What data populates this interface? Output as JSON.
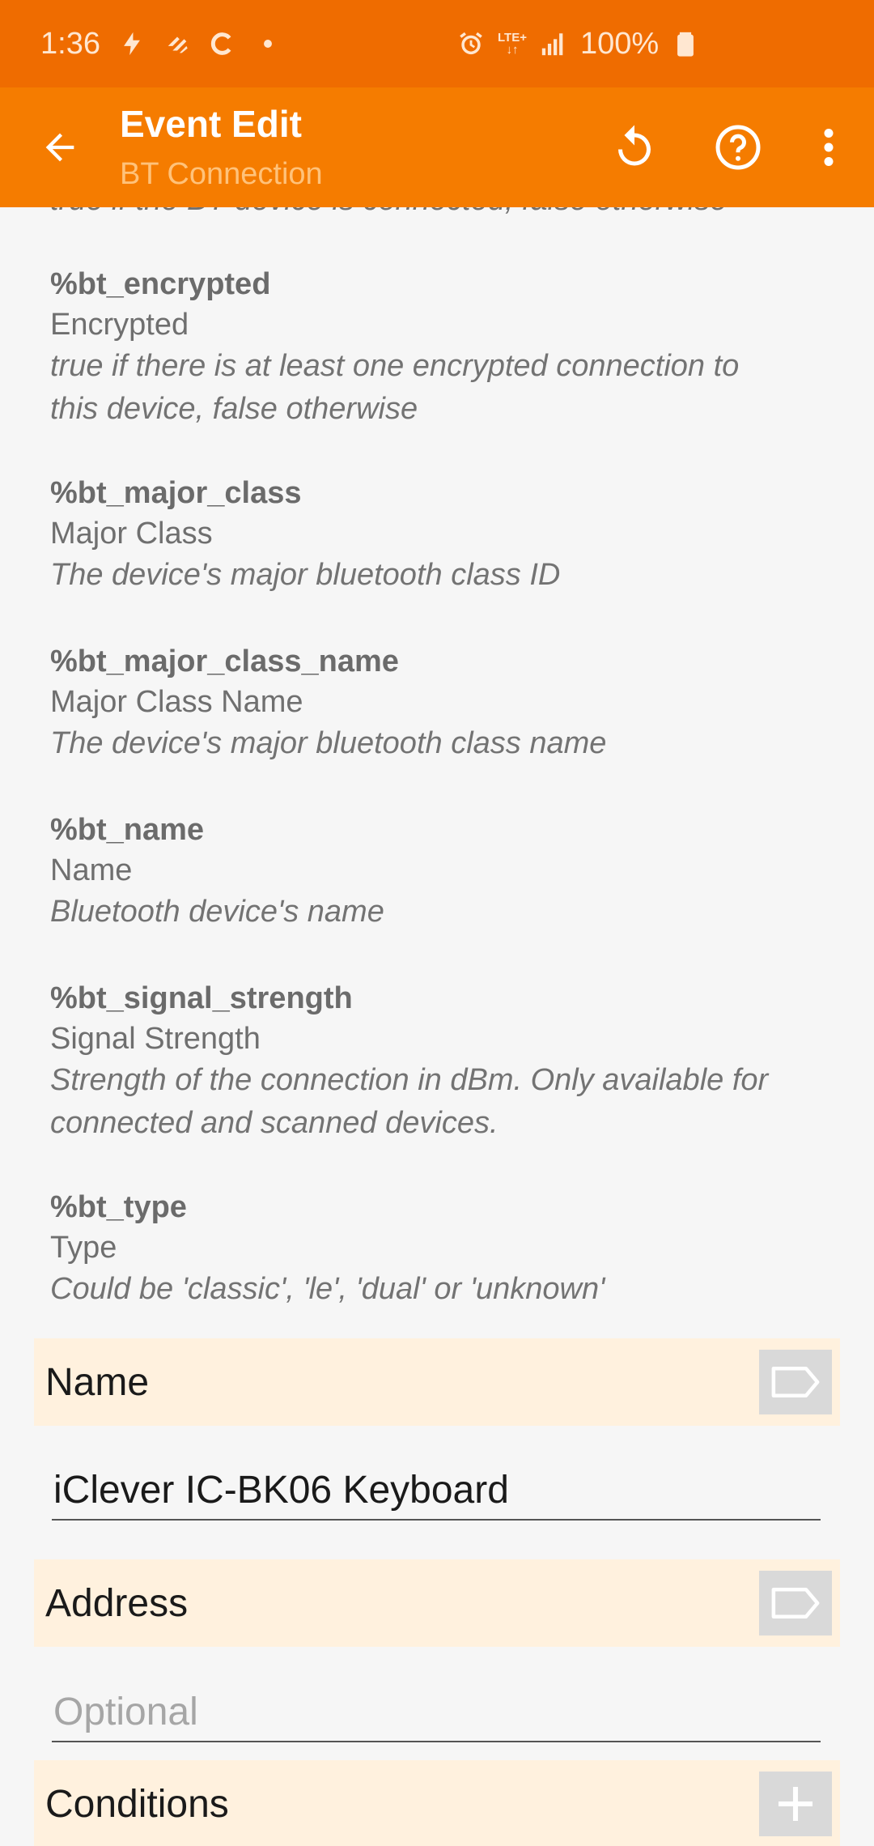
{
  "status_bar": {
    "time": "1:36",
    "battery": "100%",
    "left_icons": [
      "flash-icon",
      "bolt-app-icon",
      "c-icon",
      "dot-icon"
    ],
    "right_icons": [
      "alarm-icon",
      "lte-icon",
      "signal-icon",
      "battery-icon"
    ],
    "lte_label": "LTE+"
  },
  "app_bar": {
    "title": "Event Edit",
    "subtitle": "BT Connection"
  },
  "variables": {
    "cut_text": "true if the BT device is connected, false otherwise",
    "items": [
      {
        "name": "%bt_encrypted",
        "label": "Encrypted",
        "desc_lines": [
          "true if there is at least one encrypted connection to",
          "this device, false otherwise"
        ]
      },
      {
        "name": "%bt_major_class",
        "label": "Major Class",
        "desc_lines": [
          "The device's major bluetooth class ID"
        ]
      },
      {
        "name": "%bt_major_class_name",
        "label": "Major Class Name",
        "desc_lines": [
          "The device's major bluetooth class name"
        ]
      },
      {
        "name": "%bt_name",
        "label": "Name",
        "desc_lines": [
          "Bluetooth device's name"
        ]
      },
      {
        "name": "%bt_signal_strength",
        "label": "Signal Strength",
        "desc_lines": [
          "Strength of the connection in dBm. Only available for",
          "connected and scanned devices."
        ]
      },
      {
        "name": "%bt_type",
        "label": "Type",
        "desc_lines": [
          "Could be 'classic', 'le', 'dual' or 'unknown'"
        ]
      }
    ]
  },
  "form": {
    "name_label": "Name",
    "name_value": "iClever IC-BK06 Keyboard",
    "address_label": "Address",
    "address_placeholder": "Optional",
    "conditions_label": "Conditions"
  },
  "colors": {
    "status_bar": "#ef6c00",
    "app_bar": "#f57c00",
    "section_bg": "#fff1de"
  }
}
